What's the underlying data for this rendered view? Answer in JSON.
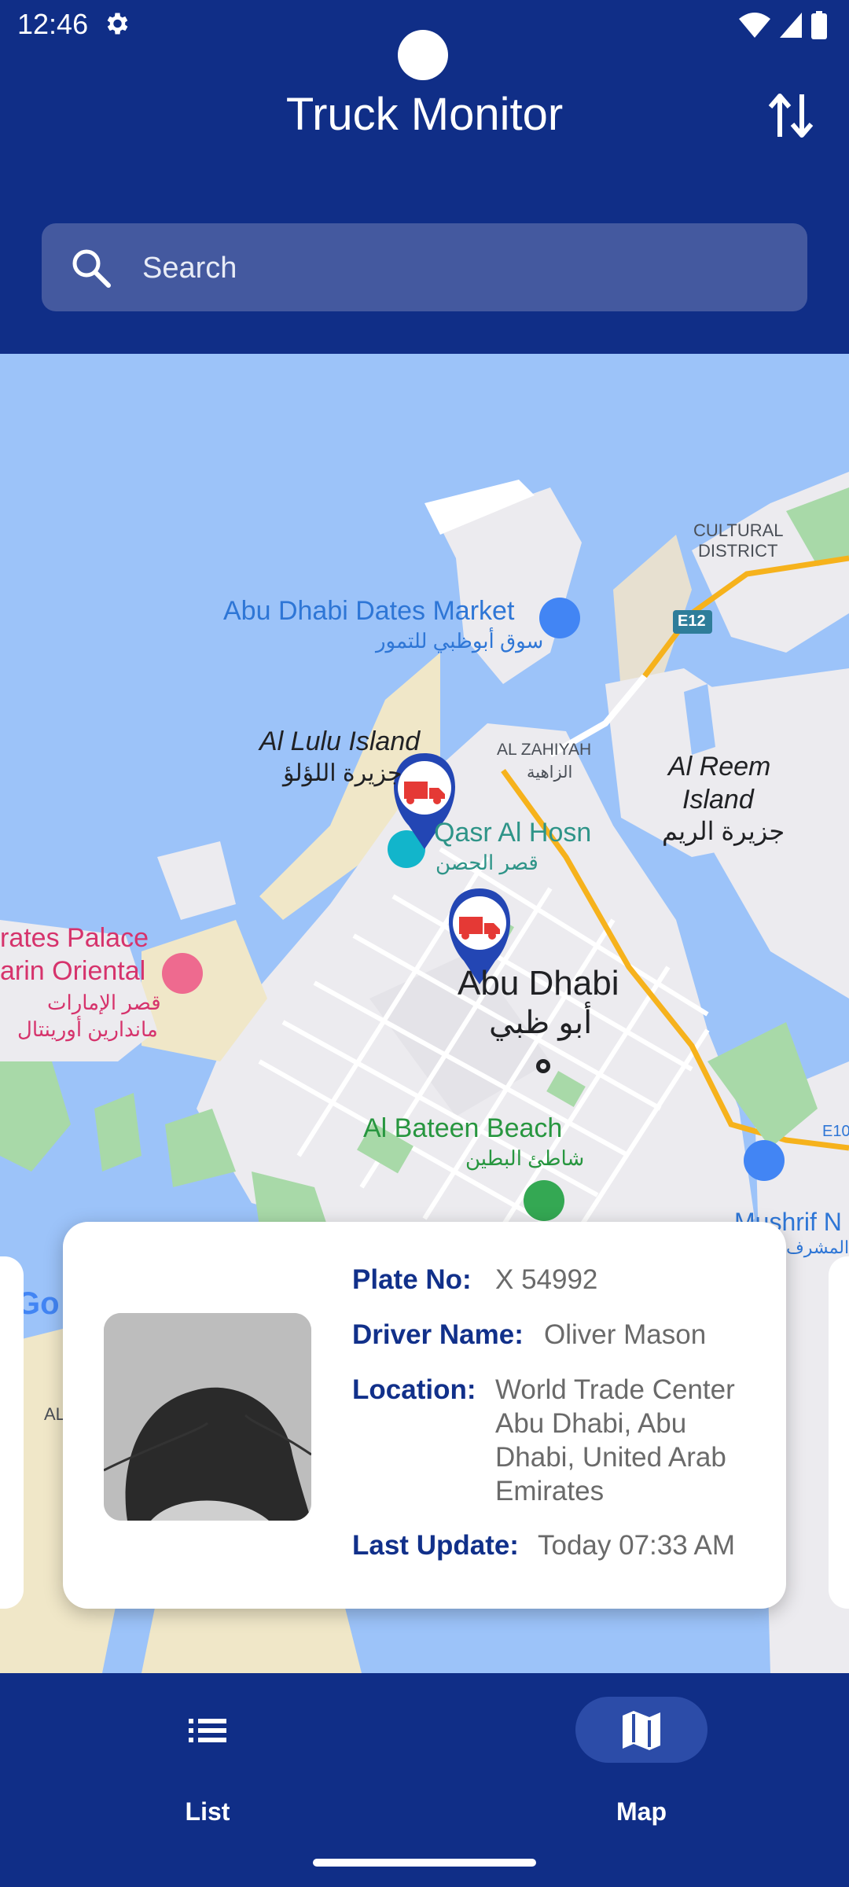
{
  "status": {
    "time": "12:46"
  },
  "app": {
    "title": "Truck Monitor"
  },
  "search": {
    "placeholder": "Search"
  },
  "map": {
    "labels": {
      "cultural1": "CULTURAL",
      "cultural2": "DISTRICT",
      "dates_market": "Abu Dhabi Dates Market",
      "dates_market_ar": "سوق أبوظبي للتمور",
      "e12": "E12",
      "lulu1": "Al Lulu Island",
      "lulu_ar": "جزيرة اللؤلؤ",
      "zahiyah": "AL ZAHIYAH",
      "zahiyah_ar": "الزاهية",
      "reem1": "Al Reem",
      "reem2": "Island",
      "reem_ar": "جزيرة الريم",
      "qasr": "Qasr Al Hosn",
      "qasr_ar": "قصر الحصن",
      "palace1": "rates Palace",
      "palace2": "arin Oriental",
      "palace_ar1": "قصر الإمارات",
      "palace_ar2": "ماندارين أورينتال",
      "city": "Abu Dhabi",
      "city_ar": "أبو ظبي",
      "bateen": "Al Bateen Beach",
      "bateen_ar": "شاطئ البطين",
      "e10": "E10",
      "mushrif": "Mushrif N",
      "mushrif_ar": "المشرف",
      "google": "Go",
      "al": "AL"
    }
  },
  "card": {
    "plate_label": "Plate No:",
    "plate_value": "X 54992",
    "driver_label": "Driver Name:",
    "driver_value": "Oliver Mason",
    "location_label": "Location:",
    "location_line1": "World Trade Center",
    "location_line2": "Abu Dhabi, Abu",
    "location_line3": "Dhabi, United Arab",
    "location_line4": "Emirates",
    "update_label": "Last Update:",
    "update_value": "Today 07:33 AM"
  },
  "nav": {
    "list_label": "List",
    "map_label": "Map"
  },
  "colors": {
    "primary": "#102E87",
    "marker": "#2346B4",
    "truck": "#E53935"
  },
  "icons": [
    "gear-icon",
    "wifi-icon",
    "signal-icon",
    "battery-icon",
    "sort-icon",
    "search-icon",
    "truck-icon",
    "list-icon",
    "map-icon"
  ]
}
